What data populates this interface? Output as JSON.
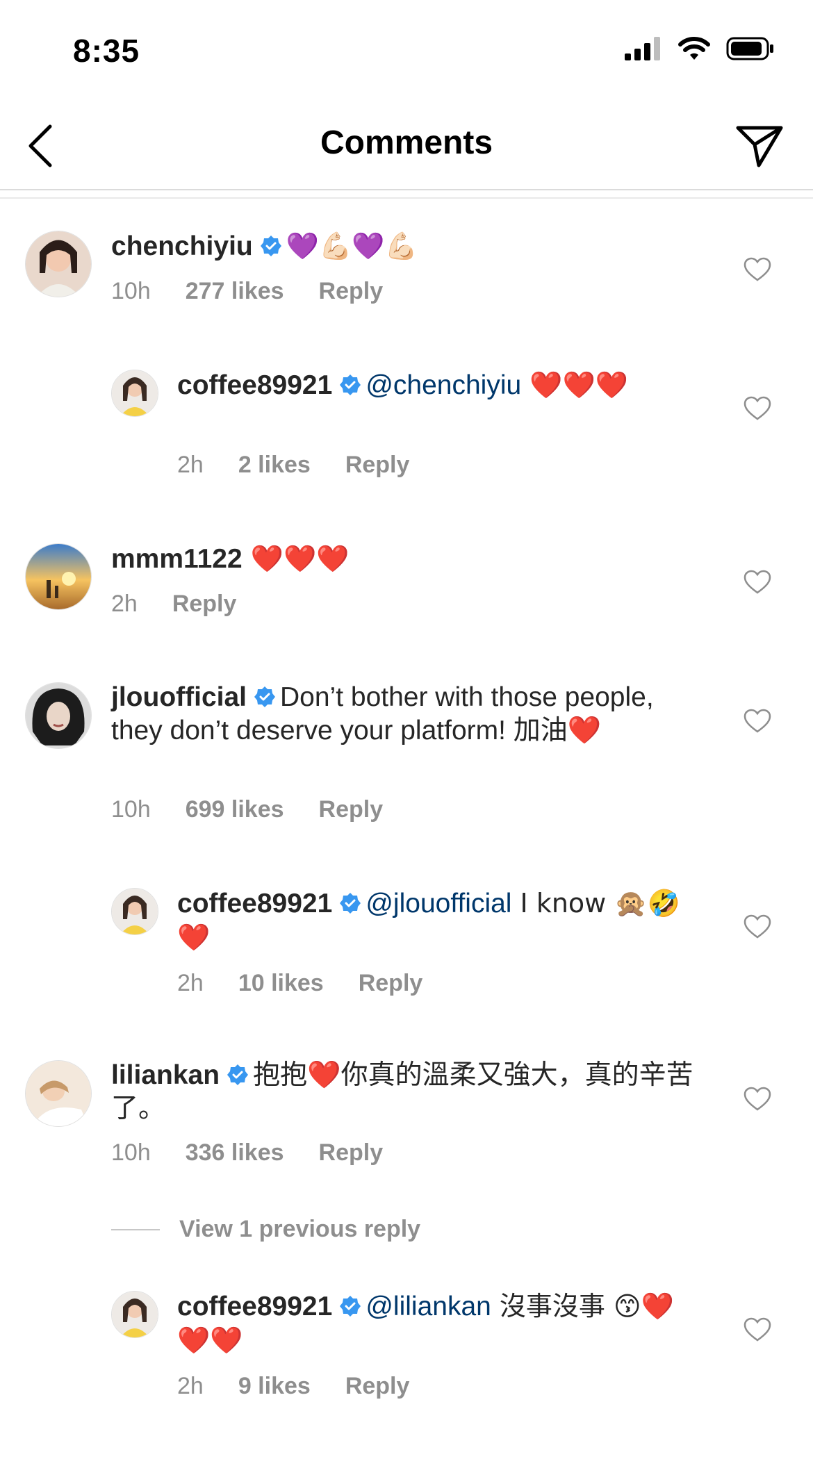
{
  "status": {
    "time": "8:35"
  },
  "header": {
    "title": "Comments"
  },
  "comments": [
    {
      "username": "chenchiyiu",
      "verified": true,
      "text": "💜💪🏻💜💪🏻",
      "time": "10h",
      "likes": "277 likes",
      "reply": "Reply"
    },
    {
      "username": "coffee89921",
      "verified": true,
      "mention": "@chenchiyiu",
      "text": " ❤️❤️❤️",
      "time": "2h",
      "likes": "2 likes",
      "reply": "Reply"
    },
    {
      "username": "mmm1122",
      "verified": false,
      "text": " ❤️❤️❤️",
      "time": "2h",
      "reply": "Reply"
    },
    {
      "username": "jlouofficial",
      "verified": true,
      "text": "Don’t bother with those people, they don’t deserve your platform! 加油❤️",
      "time": "10h",
      "likes": "699 likes",
      "reply": "Reply"
    },
    {
      "username": "coffee89921",
      "verified": true,
      "mention": "@jlouofficial",
      "text": " I know 🙊🤣❤️",
      "time": "2h",
      "likes": "10 likes",
      "reply": "Reply"
    },
    {
      "username": "liliankan",
      "verified": true,
      "text": "抱抱❤️你真的溫柔又強大，真的辛苦了。",
      "time": "10h",
      "likes": "336 likes",
      "reply": "Reply"
    },
    {
      "username": "coffee89921",
      "verified": true,
      "mention": "@liliankan",
      "text": " 沒事沒事 😙❤️❤️❤️",
      "time": "2h",
      "likes": "9 likes",
      "reply": "Reply"
    }
  ],
  "view_previous": "View 1 previous reply",
  "colors": {
    "verified": "#3897f0",
    "mention": "#00376b",
    "meta": "#8e8e8e"
  }
}
